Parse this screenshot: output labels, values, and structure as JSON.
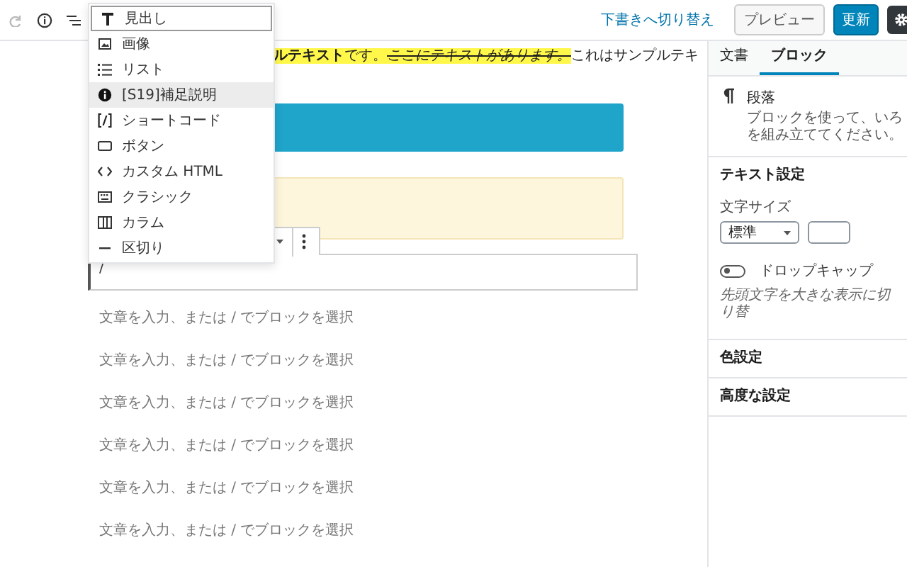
{
  "toolbar": {
    "draft_link": "下書きへ切り替え",
    "preview_button": "プレビュー",
    "update_button": "更新"
  },
  "inserter_menu": {
    "items": [
      {
        "label": "見出し",
        "focused": true,
        "hovered": false
      },
      {
        "label": "画像",
        "focused": false,
        "hovered": false
      },
      {
        "label": "リスト",
        "focused": false,
        "hovered": false
      },
      {
        "label": "[S19]補足説明",
        "focused": false,
        "hovered": true
      },
      {
        "label": "ショートコード",
        "focused": false,
        "hovered": false
      },
      {
        "label": "ボタン",
        "focused": false,
        "hovered": false
      },
      {
        "label": "カスタム HTML",
        "focused": false,
        "hovered": false
      },
      {
        "label": "クラシック",
        "focused": false,
        "hovered": false
      },
      {
        "label": "カラム",
        "focused": false,
        "hovered": false
      },
      {
        "label": "区切り",
        "focused": false,
        "hovered": false
      }
    ]
  },
  "content": {
    "paragraph": [
      {
        "text": "ルテキスト",
        "bold": true,
        "highlight": true,
        "italic": false,
        "strike": false
      },
      {
        "text": "です。",
        "bold": false,
        "highlight": true,
        "italic": false,
        "strike": false
      },
      {
        "text": "ここにテキストがあります。",
        "bold": false,
        "highlight": true,
        "italic": true,
        "strike": true
      },
      {
        "text": "これはサンプルテキ",
        "bold": false,
        "highlight": false,
        "italic": false,
        "strike": false
      }
    ],
    "active_block": {
      "text": "/"
    },
    "placeholders": [
      "文章を入力、または / でブロックを選択",
      "文章を入力、または / でブロックを選択",
      "文章を入力、または / でブロックを選択",
      "文章を入力、または / でブロックを選択",
      "文章を入力、または / でブロックを選択",
      "文章を入力、または / でブロックを選択"
    ]
  },
  "sidebar": {
    "tabs": [
      {
        "label": "文書",
        "selected": false
      },
      {
        "label": "ブロック",
        "selected": true
      }
    ],
    "block_card": {
      "title": "段落",
      "description": [
        "ブロックを使って、いろ",
        "を組み立ててください。"
      ]
    },
    "panels": [
      {
        "title": "テキスト設定",
        "font_size_label": "文字サイズ",
        "font_size_value": "標準",
        "drop_cap": {
          "label": "ドロップキャップ",
          "on": false
        },
        "hint": "先頭文字を大きな表示に切り替"
      },
      {
        "title": "色設定"
      },
      {
        "title": "高度な設定"
      }
    ]
  }
}
